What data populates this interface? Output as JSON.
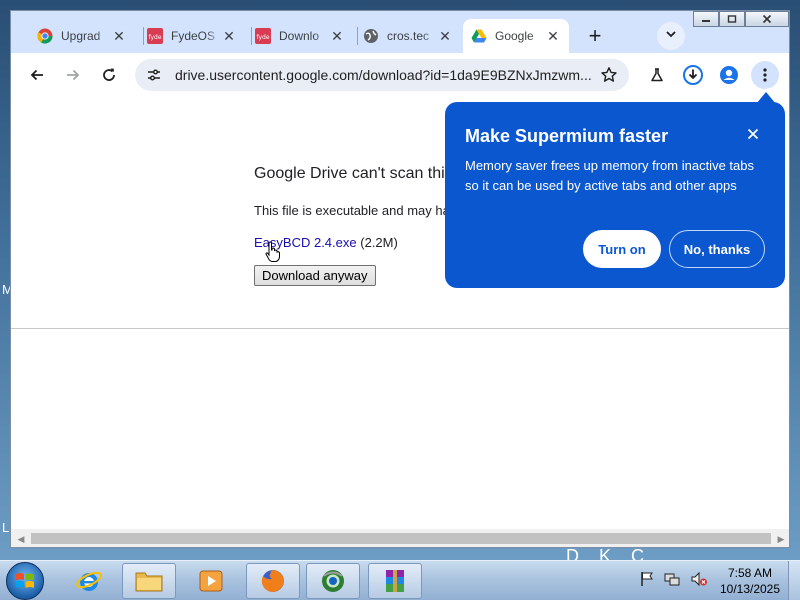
{
  "desktop": {
    "frag_left_1": "M",
    "frag_left_2": "L",
    "frag_right": "D    K    C"
  },
  "tabs": [
    {
      "label": "Upgrad",
      "icon": "chrome-icon"
    },
    {
      "label": "FydeOS",
      "icon": "fydeos-icon"
    },
    {
      "label": "Downlo",
      "icon": "fydeos-icon"
    },
    {
      "label": "cros.tec",
      "icon": "globe-icon"
    },
    {
      "label": "Google",
      "icon": "google-drive-icon",
      "active": true
    }
  ],
  "toolbar": {
    "url": "drive.usercontent.google.com/download?id=1da9E9BZNxJmzwm..."
  },
  "page": {
    "heading": "Google Drive can't scan this file for viruses.",
    "body": "This file is executable and may harm your computer.",
    "file_name": "EasyBCD 2.4.exe",
    "file_size": "(2.2M)",
    "download_label": "Download anyway"
  },
  "promo": {
    "title": "Make Supermium faster",
    "body": "Memory saver frees up memory from inactive tabs so it can be used by active tabs and other apps",
    "turn_on_label": "Turn on",
    "no_thanks_label": "No, thanks"
  },
  "taskbar": {
    "time": "7:58 AM",
    "date": "10/13/2025"
  },
  "colors": {
    "accent": "#0b57d0",
    "tabstrip": "#d3e3fd",
    "link": "#1a0dab"
  }
}
